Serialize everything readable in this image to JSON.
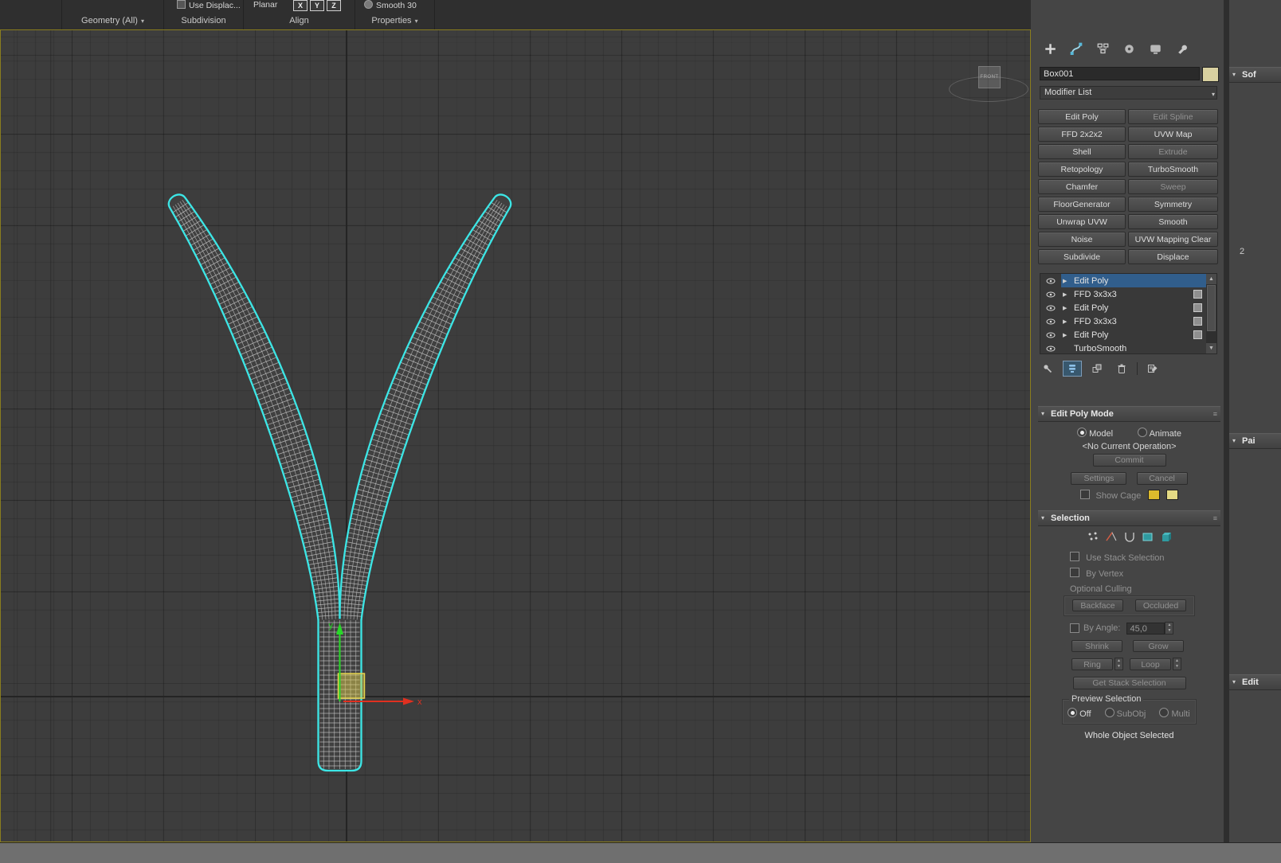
{
  "colors": {
    "selection_outline": "#3ce6e6",
    "object_fill": "#404040",
    "wireframe": "#c6c6c6",
    "gizmo_x": "#e03020",
    "gizmo_y": "#28d828",
    "plane_handle": "#e6d44e"
  },
  "icons": {
    "arrow_right": "▶",
    "chevron_down": "▾",
    "spin_up": "▲",
    "spin_down": "▼",
    "menu": "≡"
  },
  "toolbar": {
    "groups": [
      {
        "label": "Geometry (All)",
        "arrow": "▾"
      },
      {
        "label": "Subdivision",
        "item": "Use Displac..."
      },
      {
        "label": "Align",
        "planar": "Planar",
        "axis_keys": [
          "X",
          "Y",
          "Z"
        ]
      },
      {
        "label": "Properties",
        "arrow": "▾",
        "item": "Smooth 30"
      }
    ]
  },
  "viewport": {
    "viewcube_label": "FRONT",
    "axis_x_label": "x",
    "axis_y_label": "y"
  },
  "command_panel": {
    "object_name": "Box001",
    "modifier_list_label": "Modifier List",
    "modifier_buttons": [
      "Edit Poly",
      "Edit Spline",
      "FFD 2x2x2",
      "UVW Map",
      "Shell",
      "Extrude",
      "Retopology",
      "TurboSmooth",
      "Chamfer",
      "Sweep",
      "FloorGenerator",
      "Symmetry",
      "Unwrap UVW",
      "Smooth",
      "Noise",
      "UVW Mapping Clear",
      "Subdivide",
      "Displace"
    ],
    "modifier_stack": [
      "Edit Poly",
      "FFD 3x3x3",
      "Edit Poly",
      "FFD 3x3x3",
      "Edit Poly",
      "TurboSmooth"
    ],
    "edit_poly_mode": {
      "title": "Edit Poly Mode",
      "model_label": "Model",
      "animate_label": "Animate",
      "operation_status": "<No Current Operation>",
      "commit_label": "Commit",
      "settings_label": "Settings",
      "cancel_label": "Cancel",
      "show_cage_label": "Show Cage"
    },
    "selection": {
      "title": "Selection",
      "use_stack_selection_label": "Use Stack Selection",
      "by_vertex_label": "By Vertex",
      "optional_culling_label": "Optional Culling",
      "backface_label": "Backface",
      "occluded_label": "Occluded",
      "by_angle_label": "By Angle:",
      "angle_value": "45,0",
      "shrink_label": "Shrink",
      "grow_label": "Grow",
      "ring_label": "Ring",
      "loop_label": "Loop",
      "get_stack_selection_label": "Get Stack Selection",
      "preview_selection_label": "Preview Selection",
      "off_label": "Off",
      "subobj_label": "SubObj",
      "multi_label": "Multi",
      "status_text": "Whole Object Selected"
    }
  },
  "right_edge": {
    "rollouts": [
      "Sof",
      "Pai",
      "Edit"
    ],
    "spinner_value": "2"
  }
}
